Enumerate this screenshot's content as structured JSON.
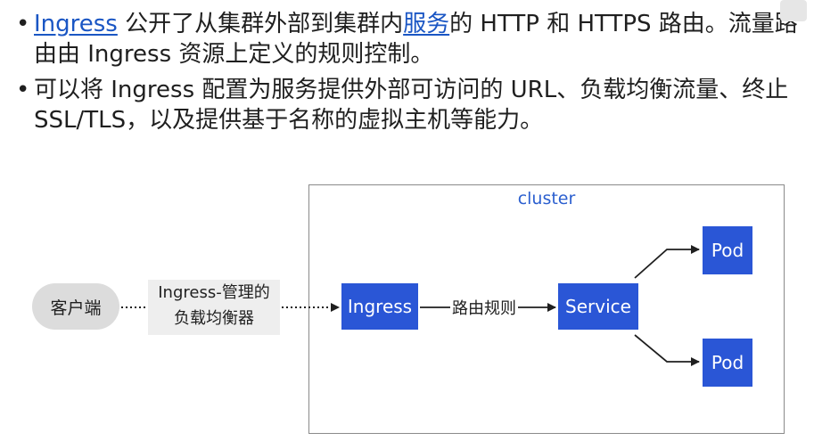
{
  "bullets": [
    {
      "link1": "Ingress",
      "text1": " 公开了从集群外部到集群内",
      "link2": "服务",
      "text2": "的 HTTP 和 HTTPS 路由。流量路由由 Ingress 资源上定义的规则控制。"
    },
    {
      "text": "可以将 Ingress 配置为服务提供外部可访问的 URL、负载均衡流量、终止 SSL/TLS，以及提供基于名称的虚拟主机等能力。"
    }
  ],
  "diagram": {
    "cluster_label": "cluster",
    "client": "客户端",
    "lb_label_line1": "Ingress-管理的",
    "lb_label_line2": "负载均衡器",
    "ingress": "Ingress",
    "route_label": "路由规则",
    "service": "Service",
    "pod_top": "Pod",
    "pod_bottom": "Pod"
  },
  "colors": {
    "link": "#1a56c4",
    "node_fill": "#2a56d6",
    "cluster_label": "#2b5fcf",
    "client_fill": "#dcdcdc"
  }
}
